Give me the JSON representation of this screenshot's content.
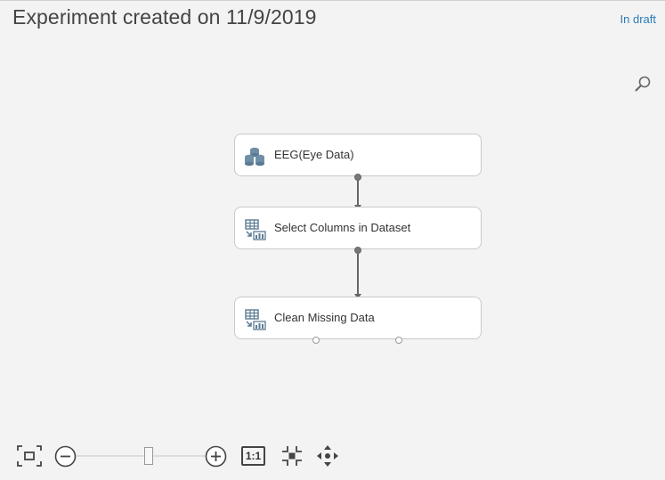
{
  "header": {
    "title": "Experiment created on 11/9/2019",
    "status": "In draft"
  },
  "canvas": {
    "nodes": [
      {
        "label": "EEG(Eye Data)",
        "icon": "dataset-icon"
      },
      {
        "label": "Select Columns in Dataset",
        "icon": "module-icon"
      },
      {
        "label": "Clean Missing Data",
        "icon": "module-icon"
      }
    ]
  },
  "toolbar": {
    "fit_icon": "fit-to-screen-icon",
    "zoom_out_icon": "zoom-out-icon",
    "zoom_in_icon": "zoom-in-icon",
    "actual_size_label": "1:1",
    "center_icon": "center-icon",
    "pan_icon": "pan-icon"
  },
  "colors": {
    "background": "#f3f3f3",
    "status_text": "#2a7ab8",
    "node_border": "#c9c9c9"
  }
}
